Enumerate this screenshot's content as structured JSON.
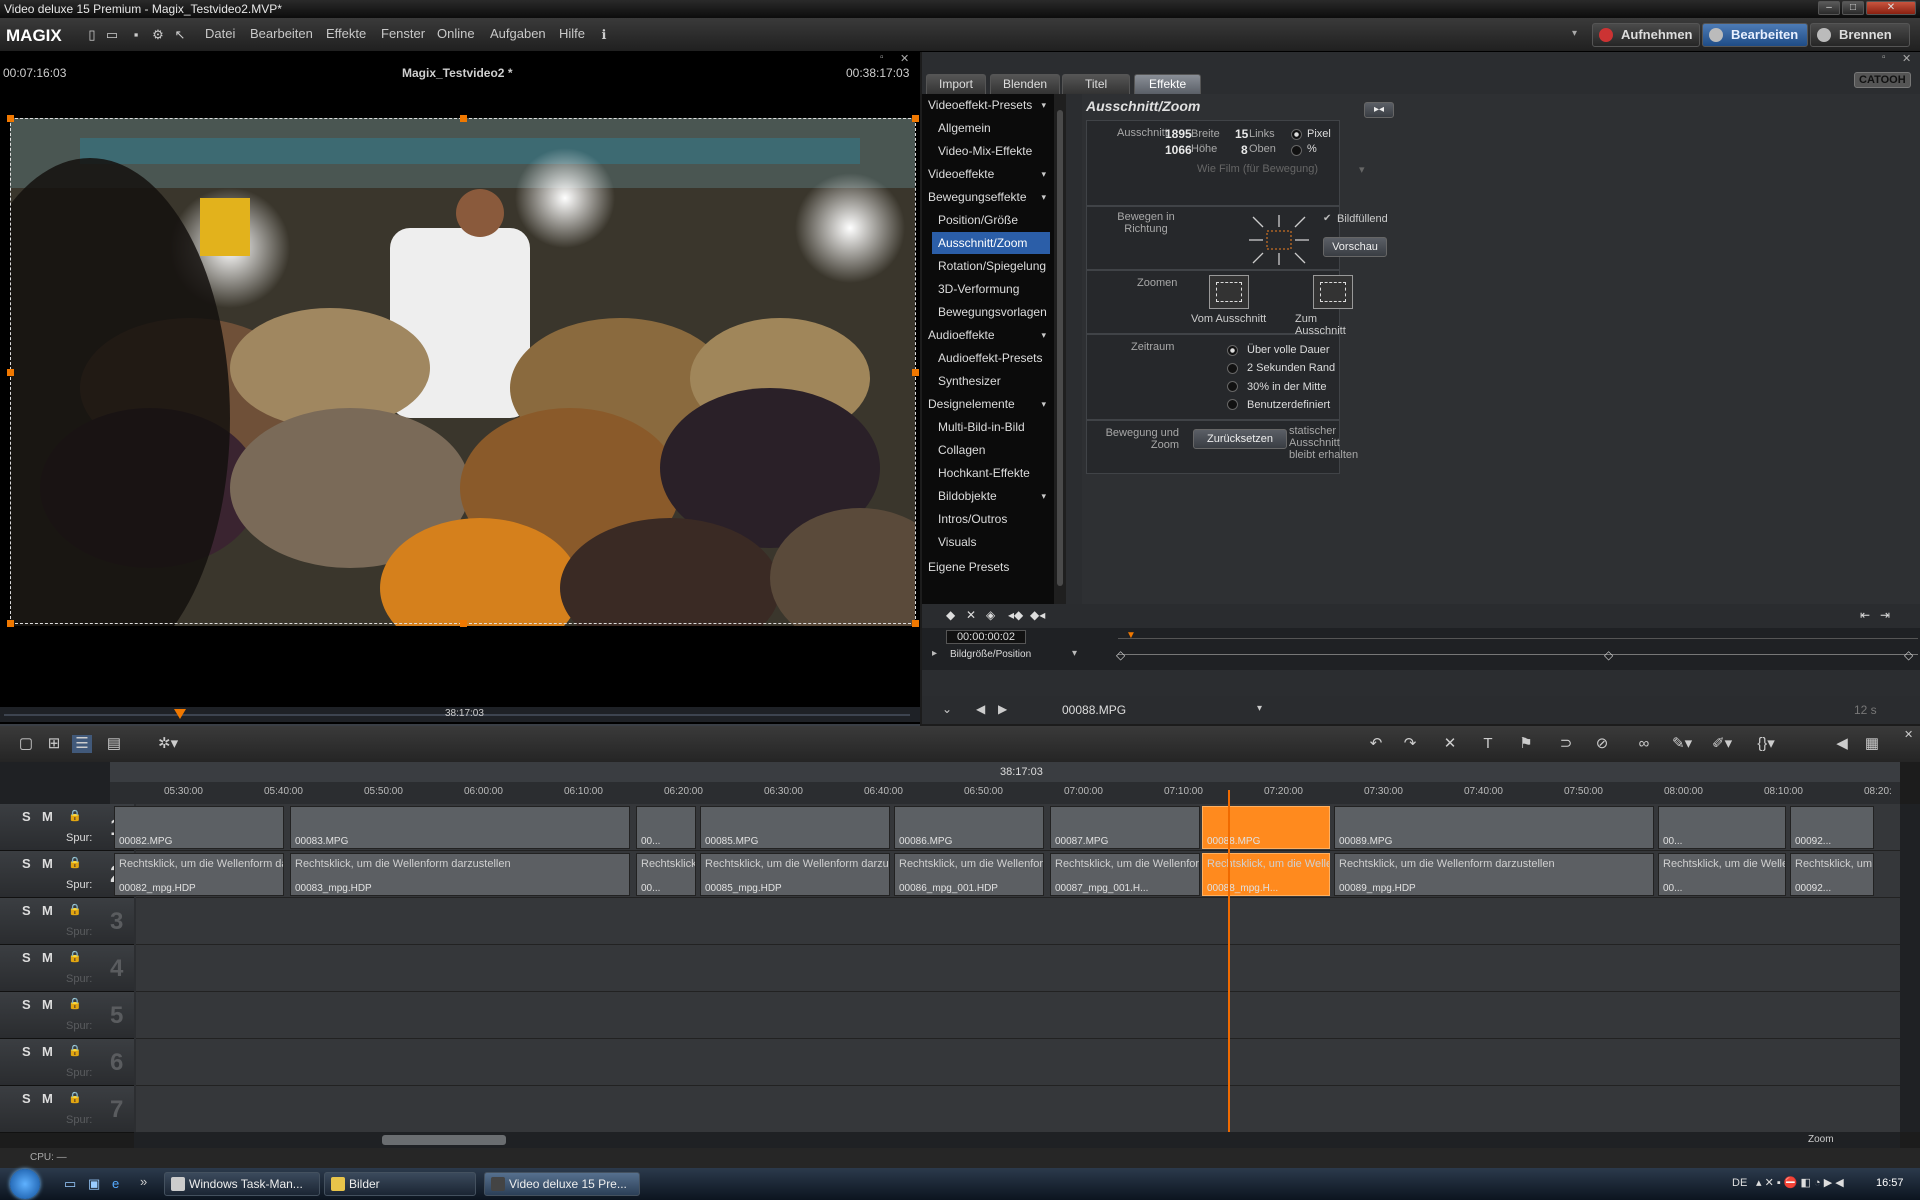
{
  "window": {
    "title": "Video deluxe 15 Premium - Magix_Testvideo2.MVP*"
  },
  "app": {
    "logo": "MAGIX"
  },
  "menu": [
    "Datei",
    "Bearbeiten",
    "Effekte",
    "Fenster",
    "Online",
    "Aufgaben",
    "Hilfe"
  ],
  "modes": {
    "record": "Aufnehmen",
    "edit": "Bearbeiten",
    "burn": "Brennen"
  },
  "preview": {
    "time_left": "00:07:16:03",
    "title": "Magix_Testvideo2 *",
    "time_right": "00:38:17:03",
    "scrub_time": "38:17:03"
  },
  "tabs": [
    "Import",
    "Blenden",
    "Titel",
    "Effekte"
  ],
  "brand": "CATOOH",
  "effects_list": {
    "items": [
      {
        "label": "Videoeffekt-Presets",
        "type": "group"
      },
      {
        "label": "Allgemein",
        "type": "sub"
      },
      {
        "label": "Video-Mix-Effekte",
        "type": "sub"
      },
      {
        "label": "Videoeffekte",
        "type": "group"
      },
      {
        "label": "Bewegungseffekte",
        "type": "group"
      },
      {
        "label": "Position/Größe",
        "type": "sub"
      },
      {
        "label": "Ausschnitt/Zoom",
        "type": "sel"
      },
      {
        "label": "Rotation/Spiegelung",
        "type": "sub"
      },
      {
        "label": "3D-Verformung",
        "type": "sub"
      },
      {
        "label": "Bewegungsvorlagen",
        "type": "sub"
      },
      {
        "label": "Audioeffekte",
        "type": "group"
      },
      {
        "label": "Audioeffekt-Presets",
        "type": "sub"
      },
      {
        "label": "Synthesizer",
        "type": "sub"
      },
      {
        "label": "Designelemente",
        "type": "group"
      },
      {
        "label": "Multi-Bild-in-Bild",
        "type": "sub"
      },
      {
        "label": "Collagen",
        "type": "sub"
      },
      {
        "label": "Hochkant-Effekte",
        "type": "sub"
      },
      {
        "label": "Bildobjekte",
        "type": "sub"
      },
      {
        "label": "Intros/Outros",
        "type": "sub"
      },
      {
        "label": "Visuals",
        "type": "sub"
      },
      {
        "label": "Eigene Presets",
        "type": "group"
      }
    ]
  },
  "crop": {
    "heading": "Ausschnitt/Zoom",
    "ausschnitt_label": "Ausschnitt",
    "breite_value": "1895",
    "breite_label": "Breite",
    "hoehe_value": "1066",
    "hoehe_label": "Höhe",
    "links_value": "15",
    "links_label": "Links",
    "oben_value": "8",
    "oben_label": "Oben",
    "unit_pixel": "Pixel",
    "unit_percent": "%",
    "preset_select": "Wie Film (für Bewegung)",
    "move_label": "Bewegen in Richtung",
    "fill_label": "Bildfüllend",
    "preview_btn": "Vorschau",
    "zoom_label": "Zoomen",
    "zoom_from": "Vom Ausschnitt",
    "zoom_to": "Zum Ausschnitt",
    "period_label": "Zeitraum",
    "period_options": [
      "Über volle Dauer",
      "2 Sekunden Rand",
      "30% in der Mitte",
      "Benutzerdefiniert"
    ],
    "motion_label": "Bewegung und Zoom",
    "reset_btn": "Zurücksetzen",
    "static_note": "statischer Ausschnitt bleibt erhalten"
  },
  "keyframes": {
    "time": "00:00:00:02",
    "track_label": "Bildgröße/Position"
  },
  "clipbar": {
    "clip_name": "00088.MPG",
    "duration": "12 s"
  },
  "timeline": {
    "position": "38:17:03",
    "ruler": [
      "05:30:00",
      "05:40:00",
      "05:50:00",
      "06:00:00",
      "06:10:00",
      "06:20:00",
      "06:30:00",
      "06:40:00",
      "06:50:00",
      "07:00:00",
      "07:10:00",
      "07:20:00",
      "07:30:00",
      "07:40:00",
      "07:50:00",
      "08:00:00",
      "08:10:00",
      "08:20:"
    ],
    "tracks": [
      {
        "num": "1",
        "spur": "Spur:"
      },
      {
        "num": "2",
        "spur": "Spur:"
      },
      {
        "num": "3",
        "spur": "Spur:"
      },
      {
        "num": "4",
        "spur": "Spur:"
      },
      {
        "num": "5",
        "spur": "Spur:"
      },
      {
        "num": "6",
        "spur": "Spur:"
      },
      {
        "num": "7",
        "spur": "Spur:"
      }
    ],
    "track_buttons": {
      "solo": "S",
      "mute": "M"
    },
    "video_clips": [
      "00082.MPG",
      "00083.MPG",
      "00...",
      "00085.MPG",
      "00086.MPG",
      "00087.MPG",
      "00088.MPG",
      "00089.MPG",
      "00...",
      "00092..."
    ],
    "audio_clips": [
      "00082_mpg.HDP",
      "00083_mpg.HDP",
      "00...",
      "00085_mpg.HDP",
      "00086_mpg_001.HDP",
      "00087_mpg_001.H...",
      "00088_mpg.H...",
      "00089_mpg.HDP",
      "00...",
      "00092..."
    ],
    "audio_hint": "Rechtsklick, um die Wellenform darzustellen",
    "zoom_label": "Zoom"
  },
  "status": {
    "cpu": "CPU: —"
  },
  "taskbar": {
    "items": [
      "Windows Task-Man...",
      "Bilder",
      "Video deluxe 15 Pre..."
    ],
    "lang": "DE",
    "clock": "16:57"
  }
}
